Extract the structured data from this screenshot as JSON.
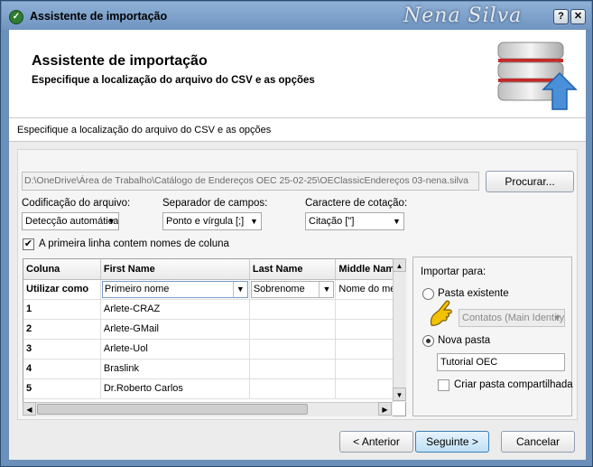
{
  "window": {
    "title": "Assistente de importação",
    "watermark": "Nena Silva",
    "controls": {
      "help": "?",
      "close": "✕"
    }
  },
  "header": {
    "title": "Assistente de importação",
    "subtitle": "Especifique a localização do arquivo do CSV e as opções"
  },
  "section_label": "Especifique a localização do arquivo do CSV e as opções",
  "file": {
    "path": "D:\\OneDrive\\Área de Trabalho\\Catálogo de Endereços OEC 25-02-25\\OEClassicEndereços 03-nena.silva",
    "browse_label": "Procurar..."
  },
  "options": {
    "encoding_label": "Codificação do arquivo:",
    "encoding_value": "Detecção automática",
    "separator_label": "Separador de campos:",
    "separator_value": "Ponto e vírgula [;]",
    "quote_label": "Caractere de cotação:",
    "quote_value": "Citação [\"]",
    "first_row_label": "A primeira linha contem nomes de coluna",
    "first_row_checked": "✔"
  },
  "grid": {
    "headers": [
      "Coluna",
      "First Name",
      "Last Name",
      "Middle Name"
    ],
    "use_as_label": "Utilizar como",
    "use_as": [
      "Primeiro nome",
      "Sobrenome",
      "Nome do meio"
    ],
    "rows": [
      {
        "num": "1",
        "first": "Arlete-CRAZ"
      },
      {
        "num": "2",
        "first": "Arlete-GMail"
      },
      {
        "num": "3",
        "first": "Arlete-Uol"
      },
      {
        "num": "4",
        "first": "Braslink"
      },
      {
        "num": "5",
        "first": "Dr.Roberto Carlos"
      }
    ]
  },
  "import_to": {
    "label": "Importar para:",
    "existing_label": "Pasta existente",
    "existing_value": "Contatos (Main Identity)",
    "new_label": "Nova pasta",
    "new_value": "Tutorial OEC",
    "shared_label": "Criar pasta compartilhada"
  },
  "buttons": {
    "back": "< Anterior",
    "next": "Seguinte >",
    "cancel": "Cancelar"
  },
  "icons": {
    "arrow_down": "▼",
    "arrow_up": "▲",
    "arrow_left": "◀",
    "arrow_right": "▶"
  }
}
